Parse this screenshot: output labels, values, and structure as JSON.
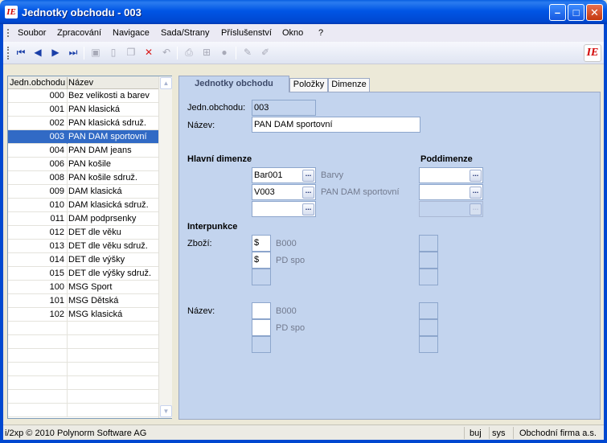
{
  "window": {
    "title": "Jednotky obchodu - 003",
    "app_icon": "IE",
    "controls": {
      "minimize": "–",
      "maximize": "□",
      "close": "✕"
    }
  },
  "menu": [
    "Soubor",
    "Zpracování",
    "Navigace",
    "Sada/Strany",
    "Příslušenství",
    "Okno",
    "?"
  ],
  "toolbar": {
    "icons": [
      "first-record-icon",
      "previous-record-icon",
      "next-record-icon",
      "last-record-icon",
      "save-icon",
      "new-document-icon",
      "copy-icon",
      "delete-icon",
      "undo-icon",
      "print-icon",
      "tree-icon",
      "circle-icon",
      "edit-icon",
      "highlight-icon"
    ],
    "logo": "IE"
  },
  "list": {
    "headers": {
      "code": "Jedn.obchodu",
      "name": "Název"
    },
    "rows": [
      {
        "code": "000",
        "name": "Bez velikosti a barev"
      },
      {
        "code": "001",
        "name": "PAN klasická"
      },
      {
        "code": "002",
        "name": "PAN klasická sdruž."
      },
      {
        "code": "003",
        "name": "PAN DAM sportovní"
      },
      {
        "code": "004",
        "name": "PAN DAM jeans"
      },
      {
        "code": "006",
        "name": "PAN košile"
      },
      {
        "code": "008",
        "name": "PAN košile sdruž."
      },
      {
        "code": "009",
        "name": "DAM klasická"
      },
      {
        "code": "010",
        "name": "DAM klasická sdruž."
      },
      {
        "code": "011",
        "name": "DAM podprsenky"
      },
      {
        "code": "012",
        "name": "DET dle věku"
      },
      {
        "code": "013",
        "name": "DET dle věku sdruž."
      },
      {
        "code": "014",
        "name": "DET dle výšky"
      },
      {
        "code": "015",
        "name": "DET dle výšky sdruž."
      },
      {
        "code": "100",
        "name": "MSG Sport"
      },
      {
        "code": "101",
        "name": "MSG Dětská"
      },
      {
        "code": "102",
        "name": "MSG klasická"
      }
    ],
    "selected_code": "003",
    "empty_rows": 7
  },
  "tabs": [
    "Jednotky obchodu",
    "Položky",
    "Dimenze"
  ],
  "form": {
    "code_label": "Jedn.obchodu:",
    "code_value": "003",
    "name_label": "Název:",
    "name_value": "PAN DAM sportovní",
    "main_dim_title": "Hlavní dimenze",
    "sub_dim_title": "Poddimenze",
    "dim1_value": "Bar001",
    "dim1_desc": "Barvy",
    "dim2_value": "V003",
    "dim2_desc": "PAN DAM sportovní",
    "interpunkce_title": "Interpunkce",
    "goods_label": "Zboží:",
    "goods_sym1": "$",
    "goods_desc1": "B000",
    "goods_sym2": "$",
    "goods_desc2": "PD spo",
    "name2_label": "Název:",
    "name2_desc1": "B000",
    "name2_desc2": "PD spo"
  },
  "status": {
    "copyright": "i/2xp © 2010 Polynorm Software AG",
    "user": "buj",
    "system": "sys",
    "company": "Obchodní firma a.s."
  },
  "colors": {
    "titlebar": "#0055e5",
    "selection": "#316ac5",
    "panel": "#c3d4ee",
    "delete_icon": "#d81b1b"
  }
}
